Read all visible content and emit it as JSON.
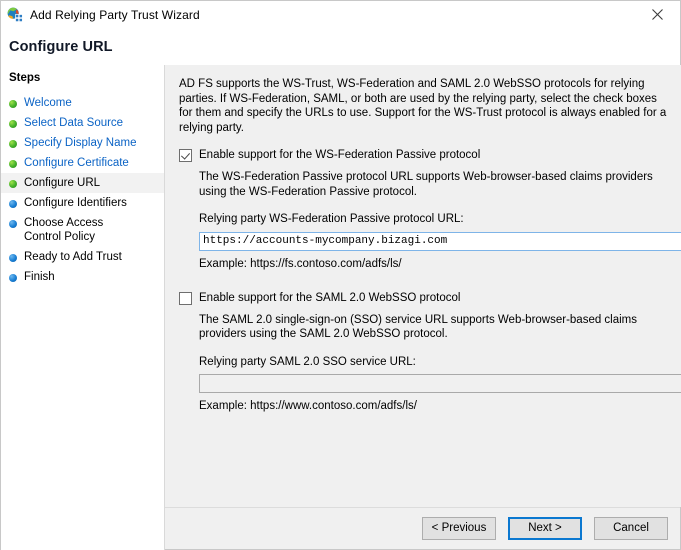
{
  "window": {
    "title": "Add Relying Party Trust Wizard",
    "icon": "adfs-globe-icon",
    "close_label": "✕"
  },
  "page": {
    "title": "Configure URL"
  },
  "sidebar": {
    "heading": "Steps",
    "items": [
      {
        "label": "Welcome",
        "state": "done",
        "dot": "green"
      },
      {
        "label": "Select Data Source",
        "state": "done",
        "dot": "green"
      },
      {
        "label": "Specify Display Name",
        "state": "done",
        "dot": "green"
      },
      {
        "label": "Configure Certificate",
        "state": "done",
        "dot": "green"
      },
      {
        "label": "Configure URL",
        "state": "current",
        "dot": "green"
      },
      {
        "label": "Configure Identifiers",
        "state": "pending",
        "dot": "blue"
      },
      {
        "label": "Choose Access Control Policy",
        "state": "pending",
        "dot": "blue"
      },
      {
        "label": "Ready to Add Trust",
        "state": "pending",
        "dot": "blue"
      },
      {
        "label": "Finish",
        "state": "pending",
        "dot": "blue"
      }
    ]
  },
  "main": {
    "intro": "AD FS supports the WS-Trust, WS-Federation and SAML 2.0 WebSSO protocols for relying parties.  If WS-Federation, SAML, or both are used by the relying party, select the check boxes for them and specify the URLs to use.  Support for the WS-Trust protocol is always enabled for a relying party.",
    "wsfed": {
      "checkbox_label": "Enable support for the WS-Federation Passive protocol",
      "checked": true,
      "description": "The WS-Federation Passive protocol URL supports Web-browser-based claims providers using the WS-Federation Passive protocol.",
      "field_label": "Relying party WS-Federation Passive protocol URL:",
      "value": "https://accounts-mycompany.bizagi.com",
      "placeholder": "",
      "example": "Example: https://fs.contoso.com/adfs/ls/"
    },
    "saml": {
      "checkbox_label": "Enable support for the SAML 2.0 WebSSO protocol",
      "checked": false,
      "description": "The SAML 2.0 single-sign-on (SSO) service URL supports Web-browser-based claims providers using the SAML 2.0 WebSSO protocol.",
      "field_label": "Relying party SAML 2.0 SSO service URL:",
      "value": "",
      "placeholder": "",
      "example": "Example: https://www.contoso.com/adfs/ls/"
    }
  },
  "footer": {
    "previous_label": "< Previous",
    "next_label": "Next >",
    "cancel_label": "Cancel"
  },
  "colors": {
    "link": "#0b63c5",
    "accent": "#0b78d0",
    "panel": "#f0f0f0",
    "step_done": "#43b02a",
    "step_pending": "#1a7fd4"
  }
}
